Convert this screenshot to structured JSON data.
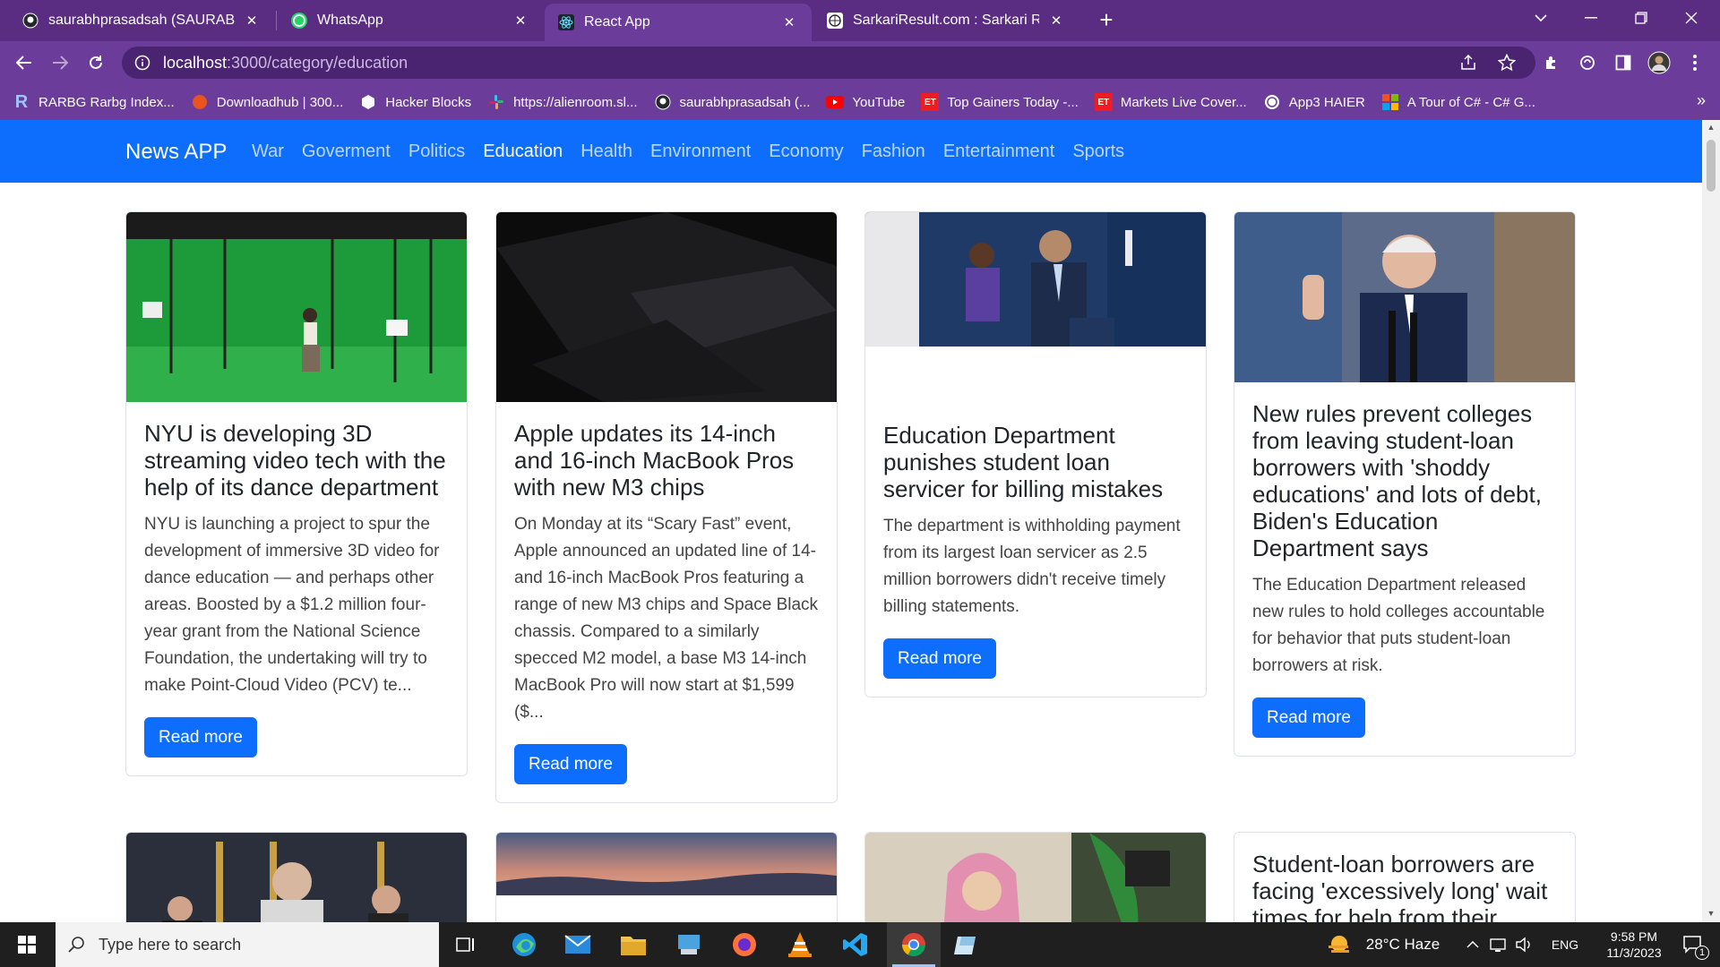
{
  "tabs": [
    {
      "title": "saurabhprasadsah (SAURABH GUPTA)",
      "icon": "github-icon",
      "active": false
    },
    {
      "title": "WhatsApp",
      "icon": "whatsapp-icon",
      "active": false
    },
    {
      "title": "React App",
      "icon": "react-icon",
      "active": true
    },
    {
      "title": "SarkariResult.com : Sarkari Result",
      "icon": "globe-icon",
      "active": false
    }
  ],
  "address": {
    "host": "localhost",
    "path": ":3000/category/education"
  },
  "bookmarks": [
    {
      "label": "RARBG Rarbg Index...",
      "icon": "rarbg-icon"
    },
    {
      "label": "Downloadhub | 300...",
      "icon": "downloadhub-icon"
    },
    {
      "label": "Hacker Blocks",
      "icon": "hackerblocks-icon"
    },
    {
      "label": "https://alienroom.sl...",
      "icon": "slack-icon"
    },
    {
      "label": "saurabhprasadsah (...",
      "icon": "github-icon"
    },
    {
      "label": "YouTube",
      "icon": "youtube-icon"
    },
    {
      "label": "Top Gainers Today -...",
      "icon": "et-icon"
    },
    {
      "label": "Markets Live Cover...",
      "icon": "et-icon"
    },
    {
      "label": "App3 HAIER",
      "icon": "globe-icon"
    },
    {
      "label": "A Tour of C# - C# G...",
      "icon": "microsoft-icon"
    }
  ],
  "navbar": {
    "brand": "News APP",
    "links": [
      "War",
      "Goverment",
      "Politics",
      "Education",
      "Health",
      "Environment",
      "Economy",
      "Fashion",
      "Entertainment",
      "Sports"
    ],
    "active": "Education"
  },
  "articles": [
    {
      "title": "NYU is developing 3D streaming video tech with the help of its dance department",
      "description": "NYU is launching a project to spur the development of immersive 3D video for dance education — and perhaps other areas. Boosted by a $1.2 million four-year grant from the National Science Foundation, the undertaking will try to make Point-Cloud Video (PCV) te...",
      "button": "Read more"
    },
    {
      "title": "Apple updates its 14-inch and 16-inch MacBook Pros with new M3 chips",
      "description": "On Monday at its “Scary Fast” event, Apple announced an updated line of 14- and 16-inch MacBook Pros featuring a range of new M3 chips and Space Black chassis. Compared to a similarly specced M2 model, a base M3 14-inch MacBook Pro will now start at $1,599 ($...",
      "button": "Read more"
    },
    {
      "title": "Education Department punishes student loan servicer for billing mistakes",
      "description": "The department is withholding payment from its largest loan servicer as 2.5 million borrowers didn't receive timely billing statements.",
      "button": "Read more"
    },
    {
      "title": "New rules prevent colleges from leaving student-loan borrowers with 'shoddy educations' and lots of debt, Biden's Education Department says",
      "description": "The Education Department released new rules to hold colleges accountable for behavior that puts student-loan borrowers at risk.",
      "button": "Read more"
    },
    {
      "title": "Student-loan borrowers are facing 'excessively long' wait times for help from their"
    }
  ],
  "taskbar": {
    "search_placeholder": "Type here to search",
    "weather": "28°C  Haze",
    "language": "ENG",
    "time": "9:58 PM",
    "date": "11/3/2023",
    "notification_count": "1"
  },
  "colors": {
    "primary": "#0d6efd",
    "chrome": "#6b3c99",
    "tabstrip": "#5a2d82"
  }
}
